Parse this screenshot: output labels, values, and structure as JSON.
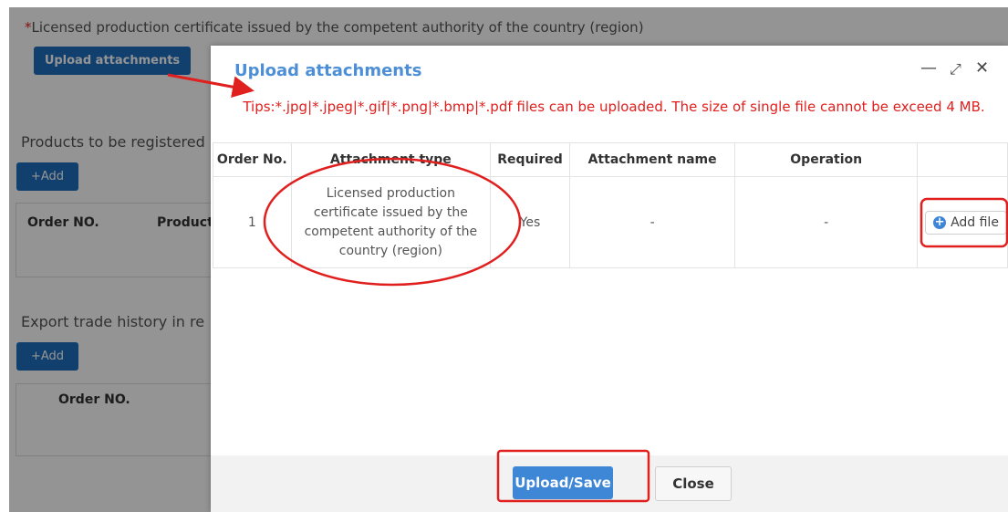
{
  "background": {
    "required_mark": "*",
    "certificate_label": "Licensed production certificate issued by the competent authority of the country (region)",
    "upload_button": "Upload attachments",
    "products_section_title": "Products to be registered",
    "add_button": "+Add",
    "products_col_order": "Order NO.",
    "products_col_product": "Product",
    "export_section_title": "Export trade history in re",
    "export_col_order": "Order NO."
  },
  "modal": {
    "title": "Upload attachments",
    "controls": {
      "minimize": "—",
      "maximize": "⤢",
      "close": "✕"
    },
    "tips": "Tips:*.jpg|*.jpeg|*.gif|*.png|*.bmp|*.pdf files can be uploaded. The size of single file cannot be exceed 4 MB.",
    "columns": {
      "order": "Order No.",
      "type": "Attachment type",
      "required": "Required",
      "name": "Attachment name",
      "operation": "Operation",
      "extra": ""
    },
    "rows": [
      {
        "order": "1",
        "type": "Licensed production certificate issued by the competent authority of the country (region)",
        "required": "Yes",
        "name": "-",
        "operation": "-",
        "action": "Add file"
      }
    ],
    "upload_save_button": "Upload/Save",
    "close_button": "Close"
  },
  "colors": {
    "accent": "#3e86d6",
    "annotation": "#e0201e",
    "title": "#4d8fd6"
  }
}
